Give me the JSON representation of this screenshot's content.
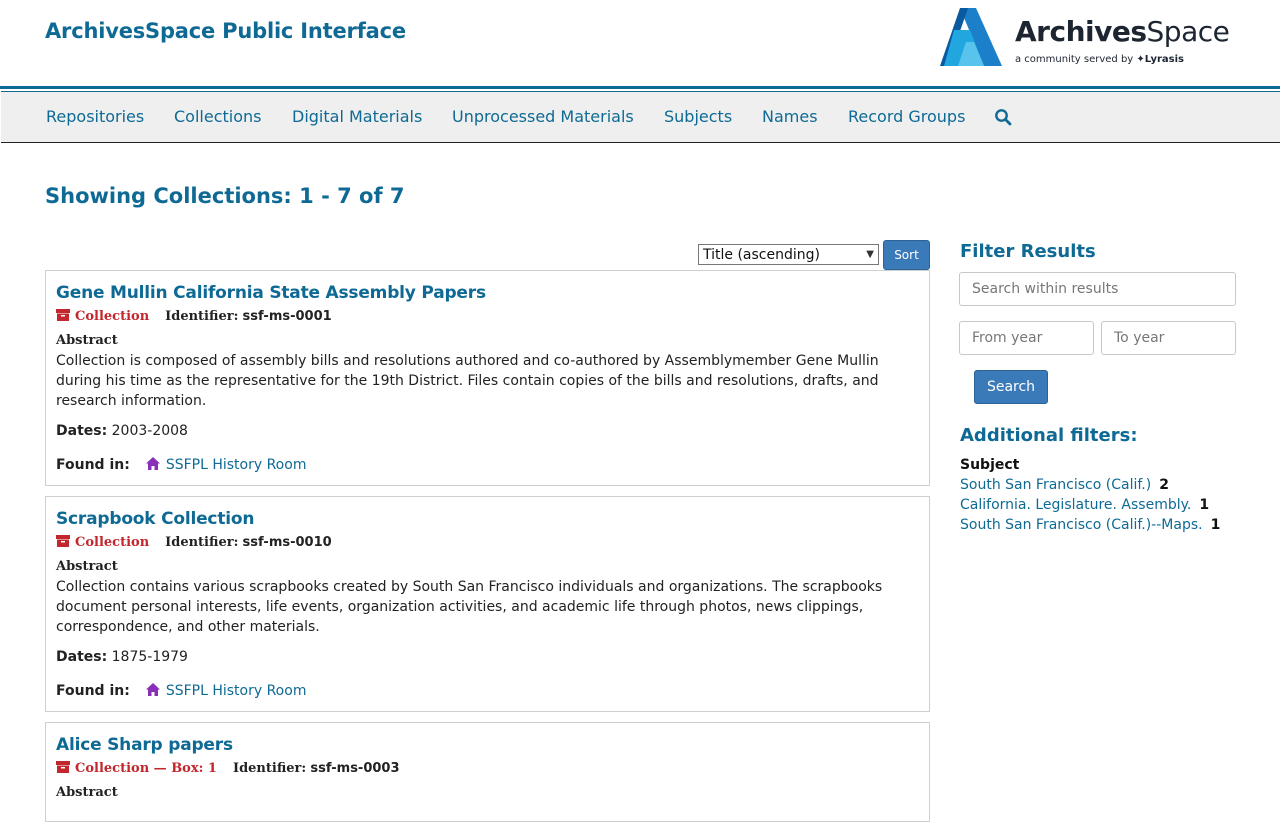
{
  "header": {
    "site_title": "ArchivesSpace Public Interface",
    "logo_word_bold": "Archives",
    "logo_word_light": "Space",
    "logo_tagline": "a community served by",
    "logo_tagline_brand": "✦Lyrasis"
  },
  "nav": {
    "items": [
      "Repositories",
      "Collections",
      "Digital Materials",
      "Unprocessed Materials",
      "Subjects",
      "Names",
      "Record Groups"
    ]
  },
  "page": {
    "heading": "Showing Collections: 1 - 7 of 7"
  },
  "sort": {
    "selected": "Title (ascending)",
    "button": "Sort"
  },
  "results": [
    {
      "title": "Gene Mullin California State Assembly Papers",
      "type": "Collection",
      "identifier_label": "Identifier:",
      "identifier": "ssf-ms-0001",
      "abstract_label": "Abstract",
      "abstract": "Collection is composed of assembly bills and resolutions authored and co-authored by Assemblymember Gene Mullin during his time as the representative for the 19th District. Files contain copies of the bills and resolutions, drafts, and research information.",
      "dates_label": "Dates:",
      "dates": "2003-2008",
      "found_label": "Found in:",
      "found_in": "SSFPL History Room"
    },
    {
      "title": "Scrapbook Collection",
      "type": "Collection",
      "identifier_label": "Identifier:",
      "identifier": "ssf-ms-0010",
      "abstract_label": "Abstract",
      "abstract": "Collection contains various scrapbooks created by South San Francisco individuals and organizations. The scrapbooks document personal interests, life events, organization activities, and academic life through photos, news clippings, correspondence, and other materials.",
      "dates_label": "Dates:",
      "dates": "1875-1979",
      "found_label": "Found in:",
      "found_in": "SSFPL History Room"
    },
    {
      "title": "Alice Sharp papers",
      "type": "Collection — Box: 1",
      "identifier_label": "Identifier:",
      "identifier": "ssf-ms-0003",
      "abstract_label": "Abstract"
    }
  ],
  "sidebar": {
    "filter_heading": "Filter Results",
    "search_placeholder": "Search within results",
    "from_placeholder": "From year",
    "to_placeholder": "To year",
    "search_button": "Search",
    "additional_heading": "Additional filters:",
    "subject_heading": "Subject",
    "facets": [
      {
        "label": "South San Francisco (Calif.)",
        "count": "2"
      },
      {
        "label": "California. Legislature. Assembly.",
        "count": "1"
      },
      {
        "label": "South San Francisco (Calif.)--Maps.",
        "count": "1"
      }
    ]
  },
  "colors": {
    "brand_blue": "#0e6a94",
    "button_blue": "#3a7ab8",
    "type_red": "#c1272d",
    "repo_purple": "#8a2fb8"
  }
}
